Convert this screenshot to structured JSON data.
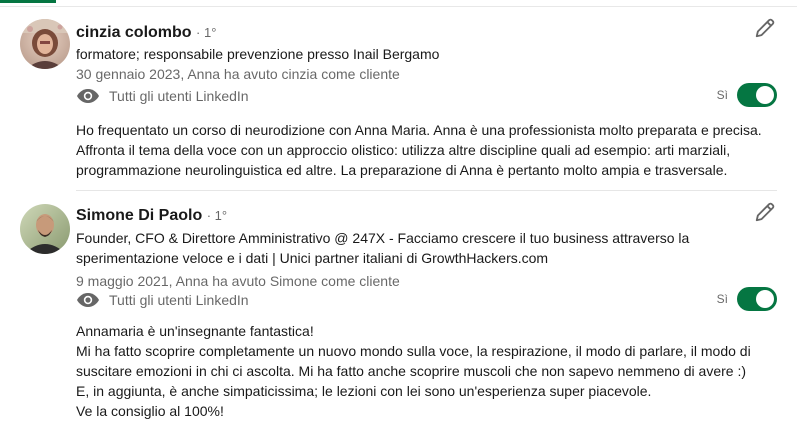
{
  "colors": {
    "accent": "#057642",
    "text_primary": "#1a1a1a",
    "text_secondary": "#666666"
  },
  "recommendations": [
    {
      "name": "cinzia colombo",
      "degree": "· 1°",
      "headline": "formatore; responsabile prevenzione presso Inail Bergamo",
      "date_relation": "30 gennaio 2023, Anna ha avuto cinzia come cliente",
      "visibility": "Tutti gli utenti LinkedIn",
      "toggle_label": "Sì",
      "toggle_on": true,
      "text": [
        "Ho frequentato un corso di neurodizione con Anna Maria. Anna è una professionista molto preparata e precisa.",
        "Affronta il tema della voce con un approccio olistico: utilizza altre discipline quali ad esempio: arti marziali,",
        "programmazione neurolinguistica ed altre. La preparazione di Anna è pertanto molto ampia e trasversale."
      ],
      "icons": {
        "edit": "pencil-icon",
        "visibility": "eye-icon"
      }
    },
    {
      "name": "Simone Di Paolo",
      "degree": "· 1°",
      "headline": "Founder, CFO & Direttore Amministrativo @ 247X - Facciamo crescere il tuo business attraverso la sperimentazione veloce e i dati | Unici partner italiani di GrowthHackers.com",
      "date_relation": "9 maggio 2021, Anna ha avuto Simone come cliente",
      "visibility": "Tutti gli utenti LinkedIn",
      "toggle_label": "Sì",
      "toggle_on": true,
      "text": [
        "Annamaria è un'insegnante fantastica!",
        "Mi ha fatto scoprire completamente un nuovo mondo sulla voce, la respirazione, il modo di parlare, il modo di",
        "suscitare emozioni in chi ci ascolta. Mi ha fatto anche scoprire muscoli che non sapevo nemmeno di avere :)",
        "E, in aggiunta, è anche simpaticissima; le lezioni con lei sono un'esperienza super piacevole.",
        "Ve la consiglio al 100%!"
      ],
      "icons": {
        "edit": "pencil-icon",
        "visibility": "eye-icon"
      }
    }
  ]
}
